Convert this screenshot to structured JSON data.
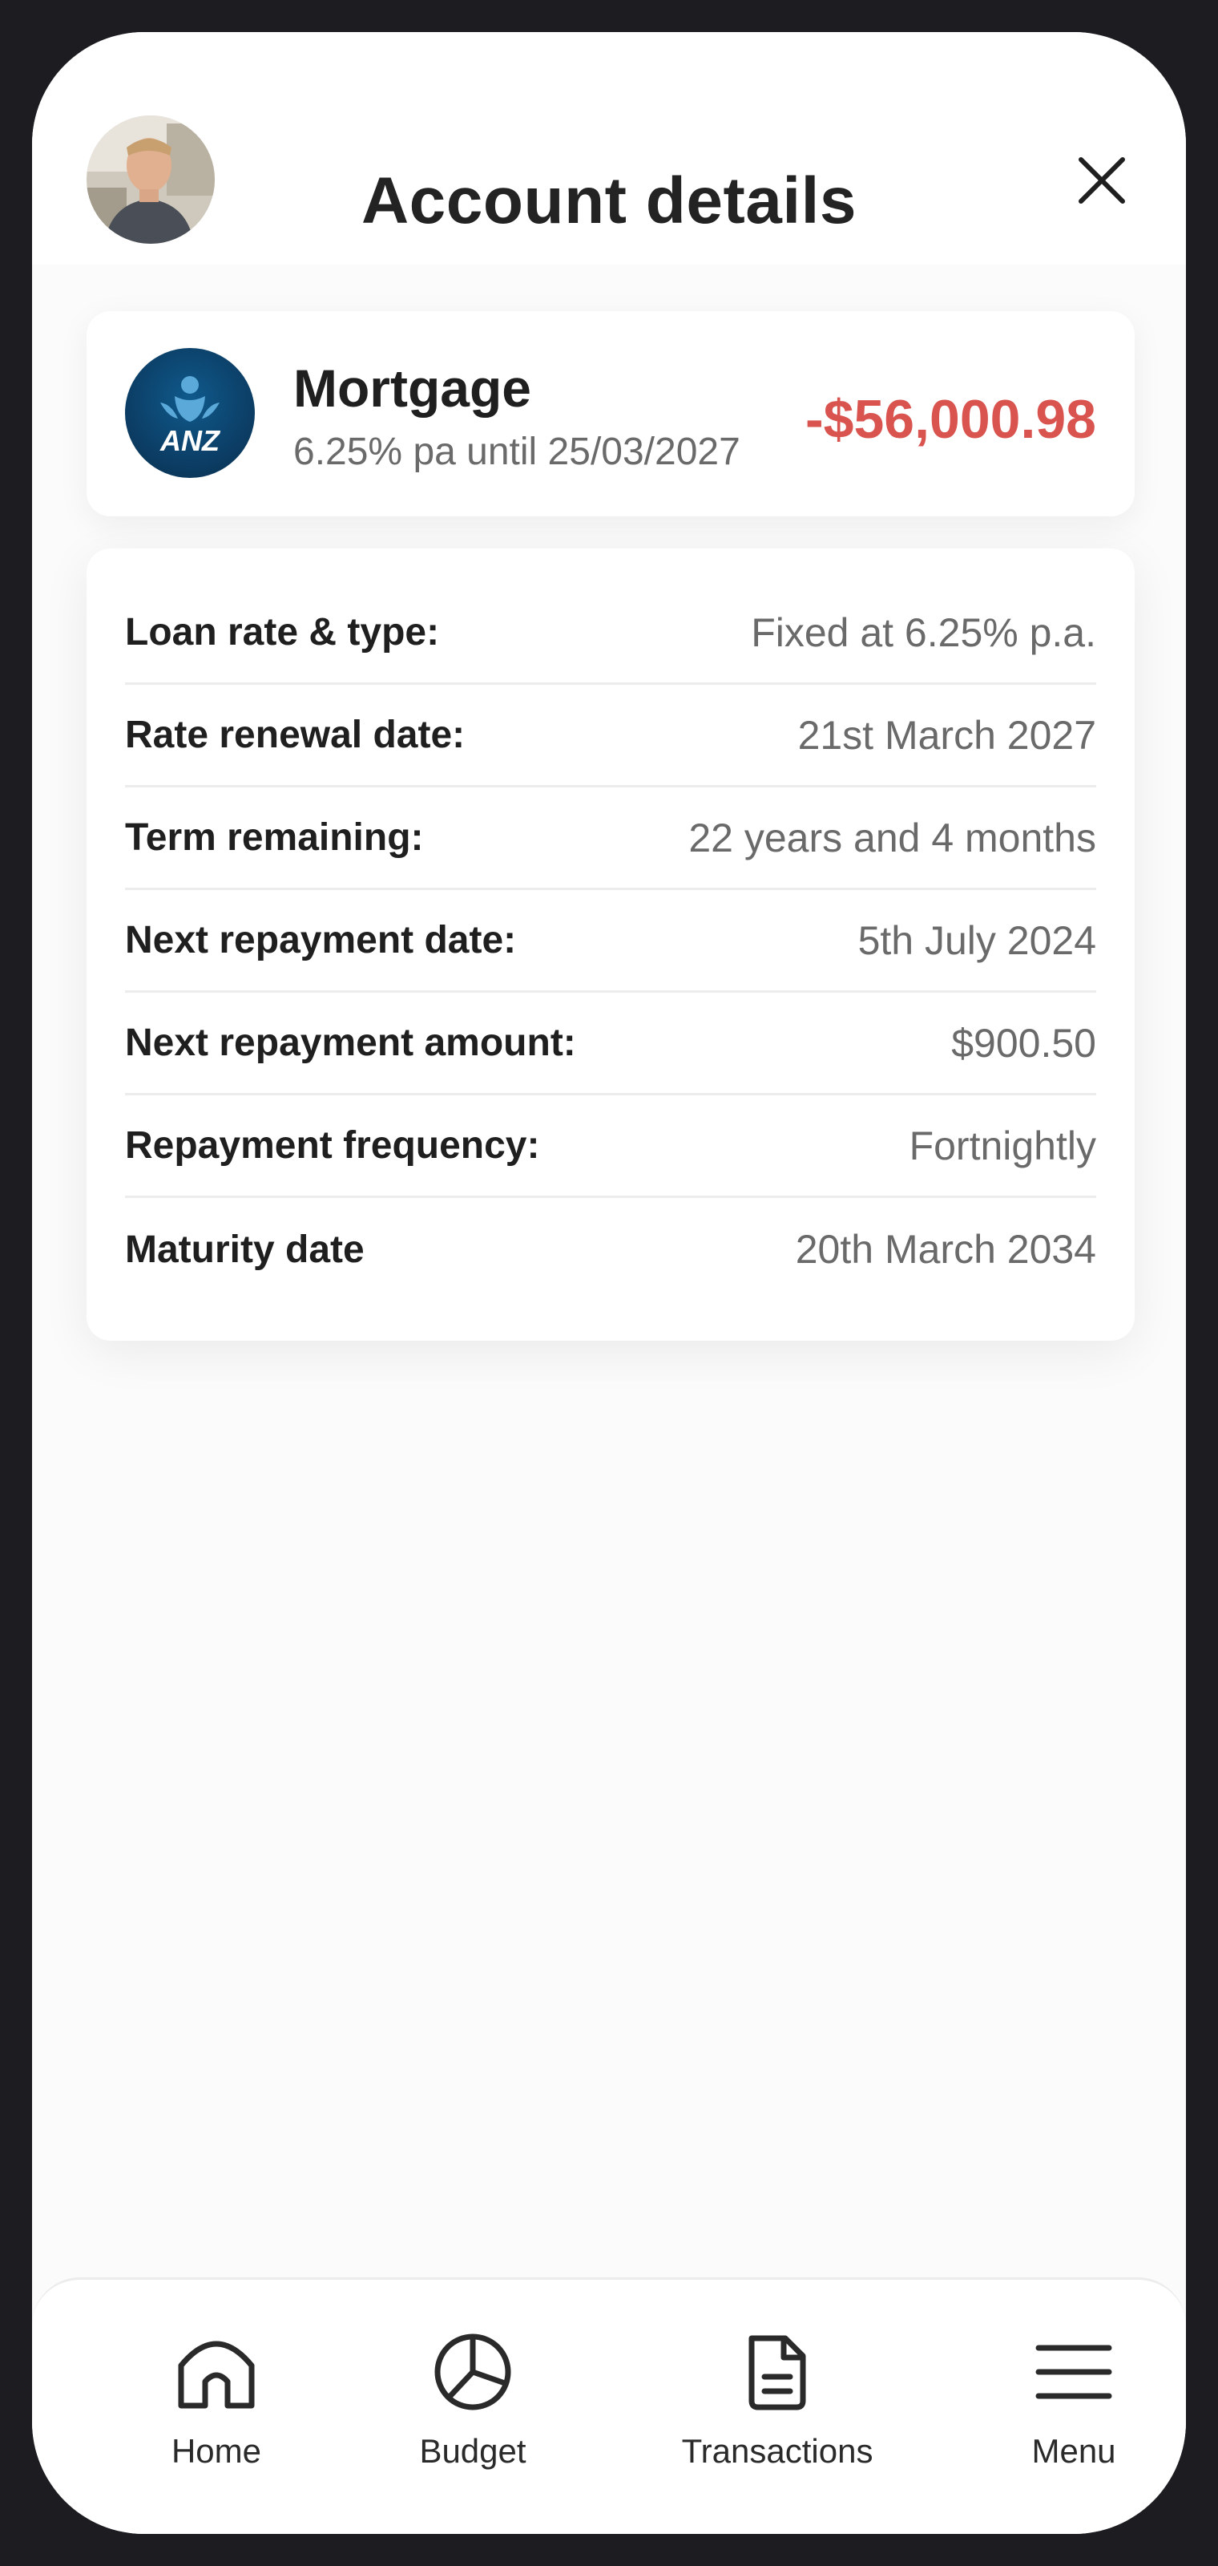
{
  "header": {
    "title": "Account details",
    "avatar_icon": "user-avatar",
    "close_icon": "close-icon"
  },
  "account": {
    "bank_logo_text": "ANZ",
    "name": "Mortgage",
    "subtitle": "6.25% pa until 25/03/2027",
    "balance": "-$56,000.98",
    "balance_color": "#d9534f"
  },
  "details": [
    {
      "label": "Loan rate & type:",
      "value": "Fixed at 6.25% p.a."
    },
    {
      "label": "Rate renewal date:",
      "value": "21st March 2027"
    },
    {
      "label": "Term remaining:",
      "value": "22 years and 4 months"
    },
    {
      "label": "Next repayment date:",
      "value": "5th July 2024"
    },
    {
      "label": "Next repayment amount:",
      "value": "$900.50"
    },
    {
      "label": "Repayment frequency:",
      "value": "Fortnightly"
    },
    {
      "label": "Maturity date",
      "value": "20th March 2034"
    }
  ],
  "nav": [
    {
      "label": "Home",
      "icon": "home-icon"
    },
    {
      "label": "Budget",
      "icon": "pie-chart-icon"
    },
    {
      "label": "Transactions",
      "icon": "document-icon"
    },
    {
      "label": "Menu",
      "icon": "hamburger-menu-icon"
    }
  ]
}
